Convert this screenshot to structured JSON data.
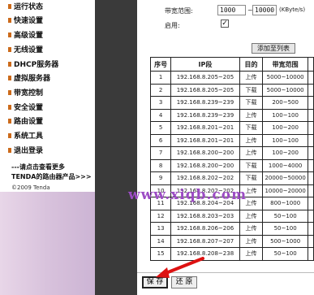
{
  "sidebar": {
    "items": [
      {
        "label": "运行状态"
      },
      {
        "label": "快速设置"
      },
      {
        "label": "高级设置"
      },
      {
        "label": "无线设置"
      },
      {
        "label": "DHCP服务器"
      },
      {
        "label": "虚拟服务器"
      },
      {
        "label": "带宽控制"
      },
      {
        "label": "安全设置"
      },
      {
        "label": "路由设置"
      },
      {
        "label": "系统工具"
      },
      {
        "label": "退出登录"
      }
    ],
    "promo_line1": "---请点击查看更多",
    "promo_line2": "TENDA的路由器产品>>>",
    "copyright": "©2009 Tenda"
  },
  "form": {
    "bandwidth_label": "带宽范围:",
    "bw_min": "1000",
    "bw_sep": "~",
    "bw_max": "10000",
    "bw_unit": "(KByte/s)",
    "enable_label": "启用:",
    "enable_checked": "✓",
    "add_button": "添加至列表"
  },
  "table": {
    "headers": [
      "序号",
      "IP段",
      "目的",
      "带宽范围"
    ],
    "rows": [
      {
        "no": "1",
        "ip": "192.168.8.205~205",
        "dir": "上传",
        "bw": "5000~10000"
      },
      {
        "no": "2",
        "ip": "192.168.8.205~205",
        "dir": "下载",
        "bw": "5000~10000"
      },
      {
        "no": "3",
        "ip": "192.168.8.239~239",
        "dir": "下载",
        "bw": "200~500"
      },
      {
        "no": "4",
        "ip": "192.168.8.239~239",
        "dir": "上传",
        "bw": "100~100"
      },
      {
        "no": "5",
        "ip": "192.168.8.201~201",
        "dir": "下载",
        "bw": "100~200"
      },
      {
        "no": "6",
        "ip": "192.168.8.201~201",
        "dir": "上传",
        "bw": "100~100"
      },
      {
        "no": "7",
        "ip": "192.168.8.200~200",
        "dir": "上传",
        "bw": "100~200"
      },
      {
        "no": "8",
        "ip": "192.168.8.200~200",
        "dir": "下载",
        "bw": "1000~4000"
      },
      {
        "no": "9",
        "ip": "192.168.8.202~202",
        "dir": "下载",
        "bw": "20000~50000"
      },
      {
        "no": "10",
        "ip": "192.168.8.202~202",
        "dir": "上传",
        "bw": "10000~20000"
      },
      {
        "no": "11",
        "ip": "192.168.8.204~204",
        "dir": "上传",
        "bw": "800~1000"
      },
      {
        "no": "12",
        "ip": "192.168.8.203~203",
        "dir": "上传",
        "bw": "50~100"
      },
      {
        "no": "13",
        "ip": "192.168.8.206~206",
        "dir": "上传",
        "bw": "50~100"
      },
      {
        "no": "14",
        "ip": "192.168.8.207~207",
        "dir": "上传",
        "bw": "500~1000"
      },
      {
        "no": "15",
        "ip": "192.168.8.208~238",
        "dir": "上传",
        "bw": "50~100"
      }
    ]
  },
  "watermark": "www.xiqb.com",
  "buttons": {
    "save": "保 存",
    "reset": "还 原"
  },
  "colors": {
    "divider": "#3a3a3a",
    "arrow": "#dd1111",
    "watermark": "#9c4cc4",
    "bullet": "#cc6a1a"
  }
}
